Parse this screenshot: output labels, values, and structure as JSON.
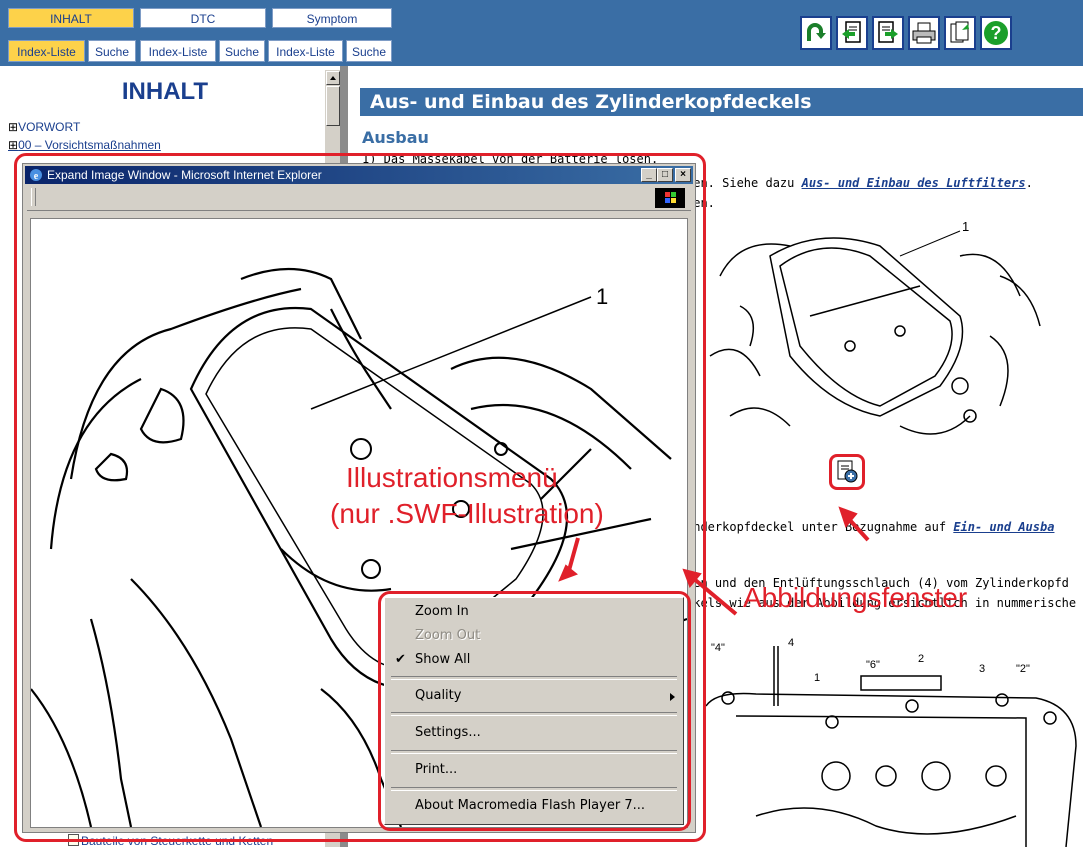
{
  "tabs": [
    {
      "label": "INHALT",
      "active": true
    },
    {
      "label": "DTC",
      "active": false
    },
    {
      "label": "Symptom",
      "active": false
    }
  ],
  "subtabs": [
    {
      "label": "Index-Liste",
      "active": true
    },
    {
      "label": "Suche",
      "active": false
    },
    {
      "label": "Index-Liste",
      "active": false
    },
    {
      "label": "Suche",
      "active": false
    },
    {
      "label": "Index-Liste",
      "active": false
    },
    {
      "label": "Suche",
      "active": false
    }
  ],
  "toolbar_icons": [
    "back-icon",
    "previous-page-icon",
    "next-page-icon",
    "print-icon",
    "export-icon",
    "help-icon"
  ],
  "sidebar": {
    "heading": "INHALT",
    "items": [
      {
        "toggle": "⊞",
        "label": "VORWORT"
      },
      {
        "toggle": "⊞",
        "label": "00 – Vorsichtsmaßnahmen"
      }
    ],
    "bottom_item": "Bauteile von Steuerkette und Ketten"
  },
  "content": {
    "title": "Aus- und Einbau des Zylinderkopfdeckels",
    "section": "Ausbau",
    "step1": "1)  Das Massekabel von der Batterie lösen.",
    "line2_text": "uen. Siehe dazu ",
    "line2_link": "Aus- und Einbau des Luftfilters",
    "line2_end": ".",
    "line3_text": "ben.",
    "line4_text": "inderkopfdeckel unter Bezugnahme auf ",
    "line4_link": "Ein- und Ausba",
    "line5_text": "gen und den Entlüftungsschlauch (4) vom Zylinderkopfd",
    "line6_text": "dkels wie aus der Abbildung ersichtlich in nummerische",
    "fig1_label": "1",
    "fig2_labels": [
      "\"4\"",
      "4",
      "1",
      "\"6\"",
      "2",
      "3",
      "\"2\""
    ]
  },
  "popup": {
    "title": "Expand Image Window - Microsoft Internet Explorer",
    "controls": [
      "_",
      "□",
      "×"
    ],
    "fig_label": "1"
  },
  "context_menu": {
    "items": [
      {
        "label": "Zoom In",
        "disabled": false,
        "checked": false
      },
      {
        "label": "Zoom Out",
        "disabled": true,
        "checked": false
      },
      {
        "label": "Show All",
        "disabled": false,
        "checked": true
      },
      {
        "label": "Quality",
        "disabled": false,
        "submenu": true
      },
      {
        "label": "Settings...",
        "disabled": false
      },
      {
        "label": "Print...",
        "disabled": false
      },
      {
        "label": "About Macromedia Flash Player 7...",
        "disabled": false
      }
    ]
  },
  "annotations": {
    "menu_label_line1": "Illustrationsmenü",
    "menu_label_line2": "(nur .SWF-Illustration)",
    "window_label": "Abbildungsfenster"
  },
  "colors": {
    "accent": "#3a6ea5",
    "highlight": "#fdd24a",
    "annotation": "#e0202a",
    "link": "#1a3f8e"
  }
}
